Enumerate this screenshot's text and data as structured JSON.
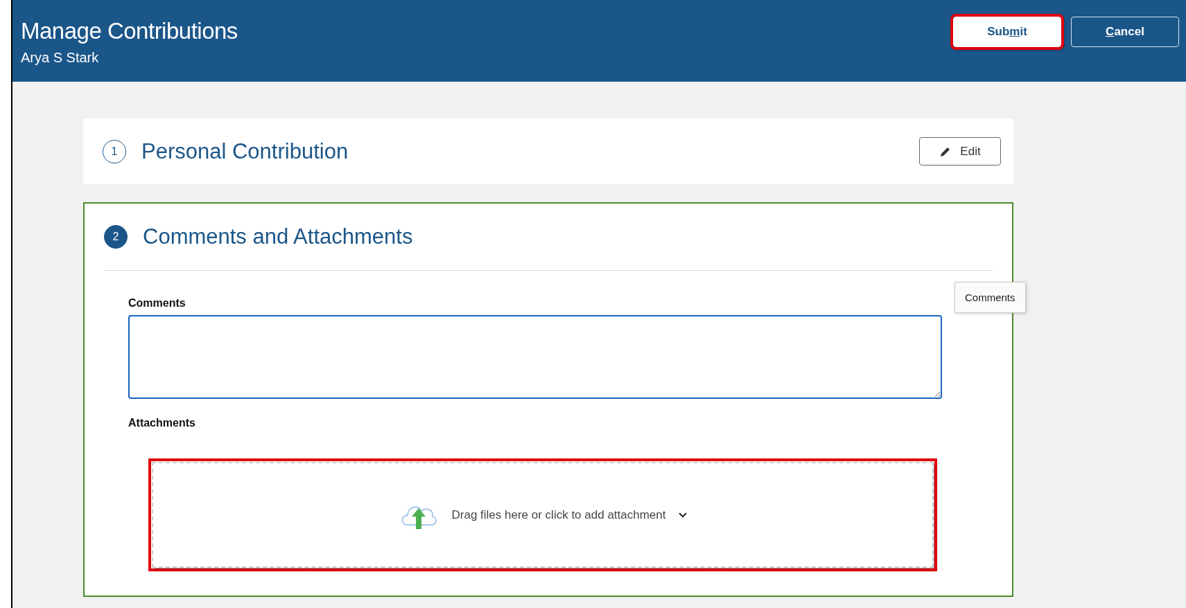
{
  "header": {
    "title": "Manage Contributions",
    "subtitle": "Arya S Stark",
    "buttons": [
      {
        "kind": "primary",
        "label_before": "Sub",
        "underlined": "m",
        "label_after": "it",
        "highlighted": true
      },
      {
        "kind": "secondary",
        "underlined": "C",
        "label_after": "ancel",
        "highlighted": false
      }
    ]
  },
  "sections": [
    {
      "number": "1",
      "title": "Personal Contribution",
      "current": false,
      "edit_button": "Edit"
    },
    {
      "number": "2",
      "title": "Comments and Attachments",
      "current": true,
      "comments": {
        "label": "Comments",
        "tooltip": "Comments"
      },
      "attachments": {
        "label": "Attachments",
        "dropzone_text": "Drag files here or click to add attachment",
        "highlighted": true
      }
    }
  ]
}
